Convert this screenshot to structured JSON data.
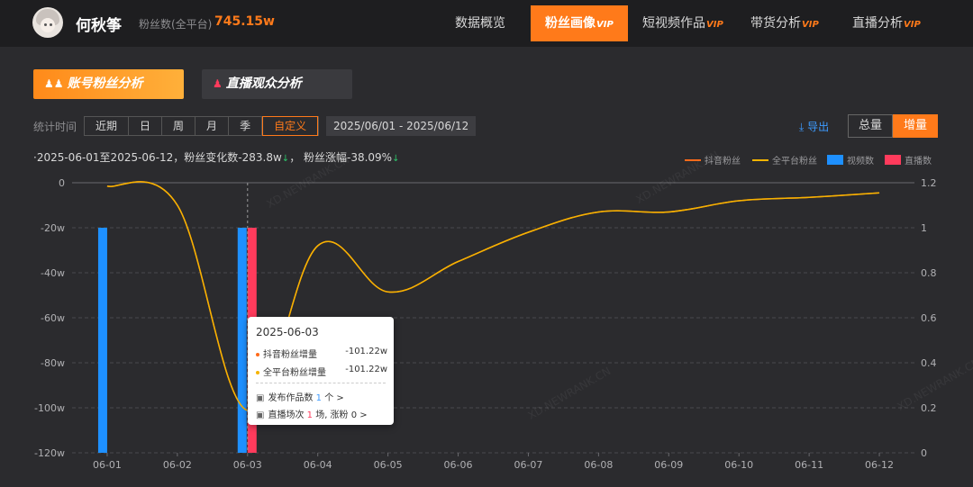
{
  "header": {
    "username": "何秋筝",
    "fans_label": "粉丝数(全平台)",
    "fans_value": "745.15w",
    "vip_tag": "VIP",
    "nav": [
      {
        "label": "数据概览",
        "vip": false
      },
      {
        "label": "粉丝画像",
        "vip": true,
        "active": true
      },
      {
        "label": "短视频作品",
        "vip": true
      },
      {
        "label": "带货分析",
        "vip": true
      },
      {
        "label": "直播分析",
        "vip": true
      }
    ]
  },
  "sections": {
    "fans_analysis": "账号粉丝分析",
    "live_audience": "直播观众分析"
  },
  "filter": {
    "label": "统计时间",
    "periods": [
      "近期",
      "日",
      "周",
      "月",
      "季",
      "自定义"
    ],
    "active_period": "自定义",
    "date_range": "2025/06/01 - 2025/06/12",
    "export_label": "导出",
    "toggle": [
      "总量",
      "增量"
    ],
    "active_toggle": "增量"
  },
  "summary": {
    "text1": "·2025-06-01至2025-06-12，粉丝变化数-283.8w",
    "text2": "，  粉丝涨幅-38.09%"
  },
  "legend": {
    "douyin": "抖音粉丝",
    "all": "全平台粉丝",
    "videos": "视频数",
    "live": "直播数"
  },
  "colors": {
    "accent": "#ff7a1a",
    "douyin_line": "#ff6a1a",
    "all_line": "#f5b400",
    "videos_bar": "#1e90ff",
    "live_bar": "#ff3b5c"
  },
  "chart_data": {
    "type": "line",
    "categories": [
      "06-01",
      "06-02",
      "06-03",
      "06-04",
      "06-05",
      "06-06",
      "06-07",
      "06-08",
      "06-09",
      "06-10",
      "06-11",
      "06-12"
    ],
    "y_left": {
      "ticks": [
        "0",
        "-20w",
        "-40w",
        "-60w",
        "-80w",
        "-100w",
        "-120w"
      ],
      "range": [
        -120,
        0
      ],
      "unit": "w"
    },
    "y_right": {
      "ticks": [
        "1.2",
        "1",
        "0.8",
        "0.6",
        "0.4",
        "0.2",
        "0"
      ],
      "range": [
        0,
        1.2
      ]
    },
    "series": [
      {
        "name": "抖音粉丝",
        "axis": "left",
        "values": [
          -1.5,
          -10,
          -101.22,
          -28,
          -48.5,
          -35,
          -22,
          -13,
          -13,
          -8,
          -6.5,
          -4.5
        ]
      },
      {
        "name": "全平台粉丝",
        "axis": "left",
        "values": [
          -1.5,
          -10,
          -101.22,
          -28,
          -48.5,
          -35,
          -22,
          -13,
          -13,
          -8,
          -6.5,
          -4.5
        ]
      },
      {
        "name": "视频数",
        "axis": "right",
        "type": "bar",
        "values": [
          1,
          0,
          1,
          0,
          0,
          0,
          0,
          0,
          0,
          0,
          0,
          0
        ]
      },
      {
        "name": "直播数",
        "axis": "right",
        "type": "bar",
        "values": [
          0,
          0,
          1,
          0,
          0,
          0,
          0,
          0,
          0,
          0,
          0,
          0
        ]
      }
    ]
  },
  "tooltip": {
    "date": "2025-06-03",
    "douyin_label": "抖音粉丝增量",
    "douyin_value": "-101.22w",
    "all_label": "全平台粉丝增量",
    "all_value": "-101.22w",
    "works_prefix": "发布作品数 ",
    "works_num": "1",
    "works_suffix": " 个  >",
    "live_prefix": "直播场次 ",
    "live_num": "1",
    "live_suffix": " 场, 涨粉 0  >"
  },
  "watermark": "XD.NEWRANK.CN"
}
